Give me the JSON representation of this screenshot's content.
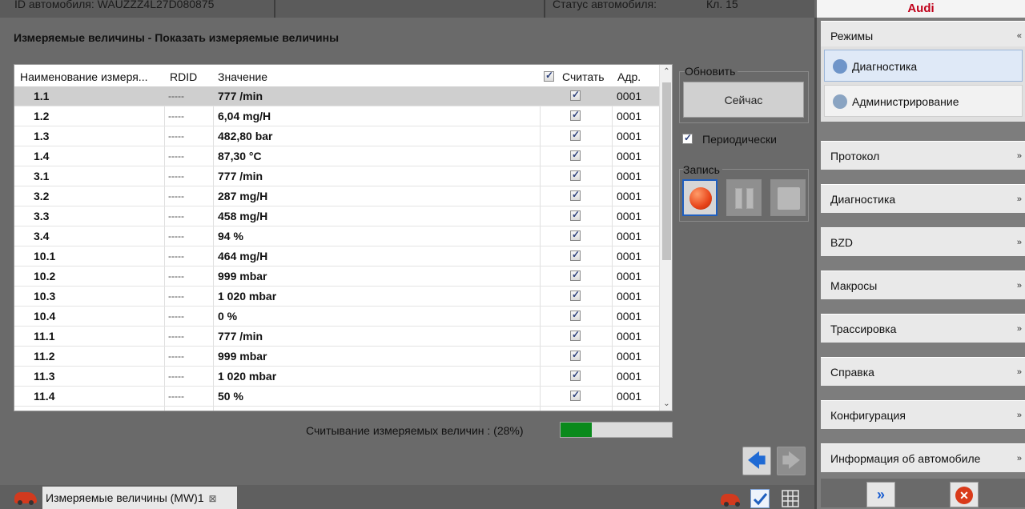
{
  "topbar": {
    "vehicle_id": "ID автомобиля:  WAUZZZ4L27D080875",
    "status_label": "Статус автомобиля:",
    "status_value": "Кл. 15",
    "brand": "Audi"
  },
  "panel": {
    "title": "Измеряемые величины - Показать измеряемые величины"
  },
  "table": {
    "headers": {
      "name": "Наименование измеря...",
      "rdid": "RDID",
      "value": "Значение",
      "read": "Считать",
      "address": "Адр."
    },
    "rows": [
      {
        "name": "1.1",
        "rdid": "-----",
        "value": "777 /min",
        "address": "0001"
      },
      {
        "name": "1.2",
        "rdid": "-----",
        "value": "6,04 mg/H",
        "address": "0001"
      },
      {
        "name": "1.3",
        "rdid": "-----",
        "value": "482,80 bar",
        "address": "0001"
      },
      {
        "name": "1.4",
        "rdid": "-----",
        "value": "87,30 °C",
        "address": "0001"
      },
      {
        "name": "3.1",
        "rdid": "-----",
        "value": "777 /min",
        "address": "0001"
      },
      {
        "name": "3.2",
        "rdid": "-----",
        "value": "287 mg/H",
        "address": "0001"
      },
      {
        "name": "3.3",
        "rdid": "-----",
        "value": "458 mg/H",
        "address": "0001"
      },
      {
        "name": "3.4",
        "rdid": "-----",
        "value": "94 %",
        "address": "0001"
      },
      {
        "name": "10.1",
        "rdid": "-----",
        "value": "464 mg/H",
        "address": "0001"
      },
      {
        "name": "10.2",
        "rdid": "-----",
        "value": "999 mbar",
        "address": "0001"
      },
      {
        "name": "10.3",
        "rdid": "-----",
        "value": "1 020 mbar",
        "address": "0001"
      },
      {
        "name": "10.4",
        "rdid": "-----",
        "value": "0 %",
        "address": "0001"
      },
      {
        "name": "11.1",
        "rdid": "-----",
        "value": "777 /min",
        "address": "0001"
      },
      {
        "name": "11.2",
        "rdid": "-----",
        "value": "999 mbar",
        "address": "0001"
      },
      {
        "name": "11.3",
        "rdid": "-----",
        "value": "1 020 mbar",
        "address": "0001"
      },
      {
        "name": "11.4",
        "rdid": "-----",
        "value": "50 %",
        "address": "0001"
      }
    ]
  },
  "controls": {
    "refresh_group": "Обновить",
    "now_button": "Сейчас",
    "periodic_label": "Периодически",
    "record_group": "Запись"
  },
  "progress": {
    "label": "Считывание измеряемых величин : (28%)",
    "fraction": 0.28,
    "color": "#0a8a1c"
  },
  "taskbar": {
    "tab_label": "Измеряемые величины (MW)1",
    "tab_close": "⊠"
  },
  "sidebar": {
    "modes_header": "Режимы",
    "modes": [
      {
        "label": "Диагностика",
        "icon": "stethoscope-icon",
        "active": true
      },
      {
        "label": "Администрирование",
        "icon": "admin-gear-icon",
        "active": false
      }
    ],
    "sections": [
      "Протокол",
      "Диагностика",
      "BZD",
      "Макросы",
      "Трассировка",
      "Справка",
      "Конфигурация",
      "Информация об автомобиле"
    ]
  },
  "icons": {
    "expand": "»",
    "collapse": "«",
    "next": "»",
    "exit": "✕",
    "back": "🡄",
    "forward": "🡆"
  }
}
